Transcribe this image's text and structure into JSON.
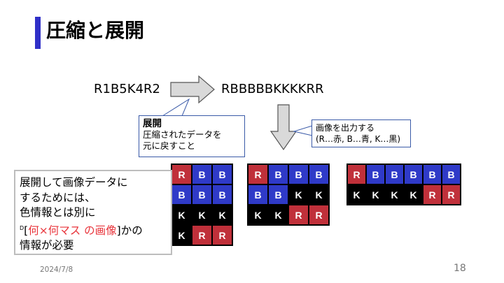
{
  "slide": {
    "title": "圧縮と展開",
    "compressed": "R1B5K4R2",
    "expanded": "RBBBBBKKKKRR",
    "callout_expand": {
      "heading": "展開",
      "line1": "圧縮されたデータを",
      "line2": "元に戻すこと"
    },
    "callout_output": {
      "line1": "画像を出力する",
      "line2": "(R…赤, B…青, K…黒)"
    },
    "note": {
      "line1": "展開して画像データに",
      "line2": "するためには、",
      "line3": "色情報とは別に",
      "sup": "D",
      "bracket_open": "[",
      "highlight": "何×何マス の画像",
      "bracket_close": "]かの",
      "line5": "情報が必要"
    },
    "grids": [
      {
        "name": "grid-3x4",
        "cols": 3,
        "cells": [
          "R",
          "B",
          "B",
          "B",
          "B",
          "B",
          "K",
          "K",
          "K",
          "K",
          "R",
          "R"
        ]
      },
      {
        "name": "grid-4x3",
        "cols": 4,
        "cells": [
          "R",
          "B",
          "B",
          "B",
          "B",
          "B",
          "K",
          "K",
          "K",
          "K",
          "R",
          "R"
        ]
      },
      {
        "name": "grid-6x2",
        "cols": 6,
        "cells": [
          "R",
          "B",
          "B",
          "B",
          "B",
          "B",
          "K",
          "K",
          "K",
          "K",
          "R",
          "R"
        ]
      }
    ],
    "colors": {
      "R": "#c0303a",
      "B": "#2f3ac8",
      "K": "#000000",
      "accent": "#3030c8"
    },
    "footer_date": "2024/7/8",
    "page_number": "18"
  }
}
